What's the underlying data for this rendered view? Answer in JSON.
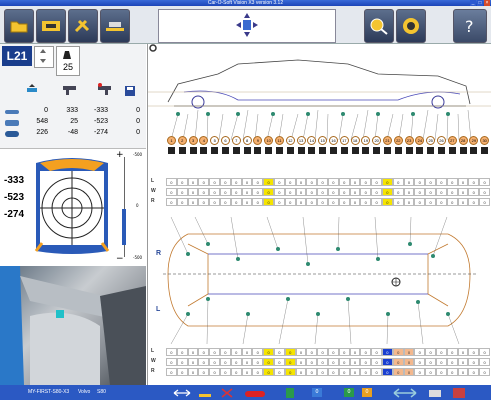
{
  "window": {
    "title": "Car-O-Soft Vision X3 version 3.12",
    "minimize": "_",
    "maximize": "□",
    "close": "×"
  },
  "vehicle": {
    "code": "L21",
    "load": "25"
  },
  "measurements": {
    "headers_icons": [
      "car-up-icon",
      "gun-icon",
      "gun-flip-icon",
      "save-icon"
    ],
    "rows": [
      {
        "icon": "car-side-icon",
        "values": [
          "0",
          "333",
          "-333",
          "0"
        ]
      },
      {
        "icon": "car-front-icon",
        "values": [
          "548",
          "25",
          "-523",
          "0"
        ]
      },
      {
        "icon": "car-top-icon",
        "values": [
          "226",
          "-48",
          "-274",
          "0"
        ]
      }
    ]
  },
  "gauge": {
    "values": [
      "-333",
      "-523",
      "-274"
    ],
    "scale_top": "-500",
    "scale_mid": "0",
    "scale_bottom": "-500",
    "plus": "+",
    "minus": "−"
  },
  "grid": {
    "row_labels_top": [
      "L",
      "W",
      "R"
    ],
    "row_labels_bottom": [
      "L",
      "W",
      "R"
    ],
    "side_labels": [
      "R",
      "L"
    ],
    "point_numbers": [
      "1",
      "2",
      "3",
      "4",
      "5",
      "6",
      "7",
      "8",
      "9",
      "10",
      "11",
      "12",
      "13",
      "14",
      "15",
      "16",
      "17",
      "18",
      "19",
      "20",
      "21",
      "22",
      "23",
      "24",
      "25",
      "26",
      "27",
      "28",
      "29",
      "30"
    ],
    "highlighted_points": [
      "1",
      "2",
      "3",
      "4",
      "9",
      "10",
      "11",
      "21",
      "22",
      "23",
      "24",
      "27",
      "28",
      "29",
      "30"
    ],
    "cell_value": "0",
    "top_yellow_col": 10,
    "top_yellow_col2": 21,
    "bottom_yellow_cols": [
      10,
      12
    ],
    "bottom_blue_col": 21,
    "bottom_orange_cols": [
      22,
      23
    ]
  },
  "status": {
    "profile": "MY-FIRST-S80-X3",
    "make": "Volvo",
    "model": "S80",
    "codes": [
      "0",
      "0",
      "0"
    ]
  }
}
